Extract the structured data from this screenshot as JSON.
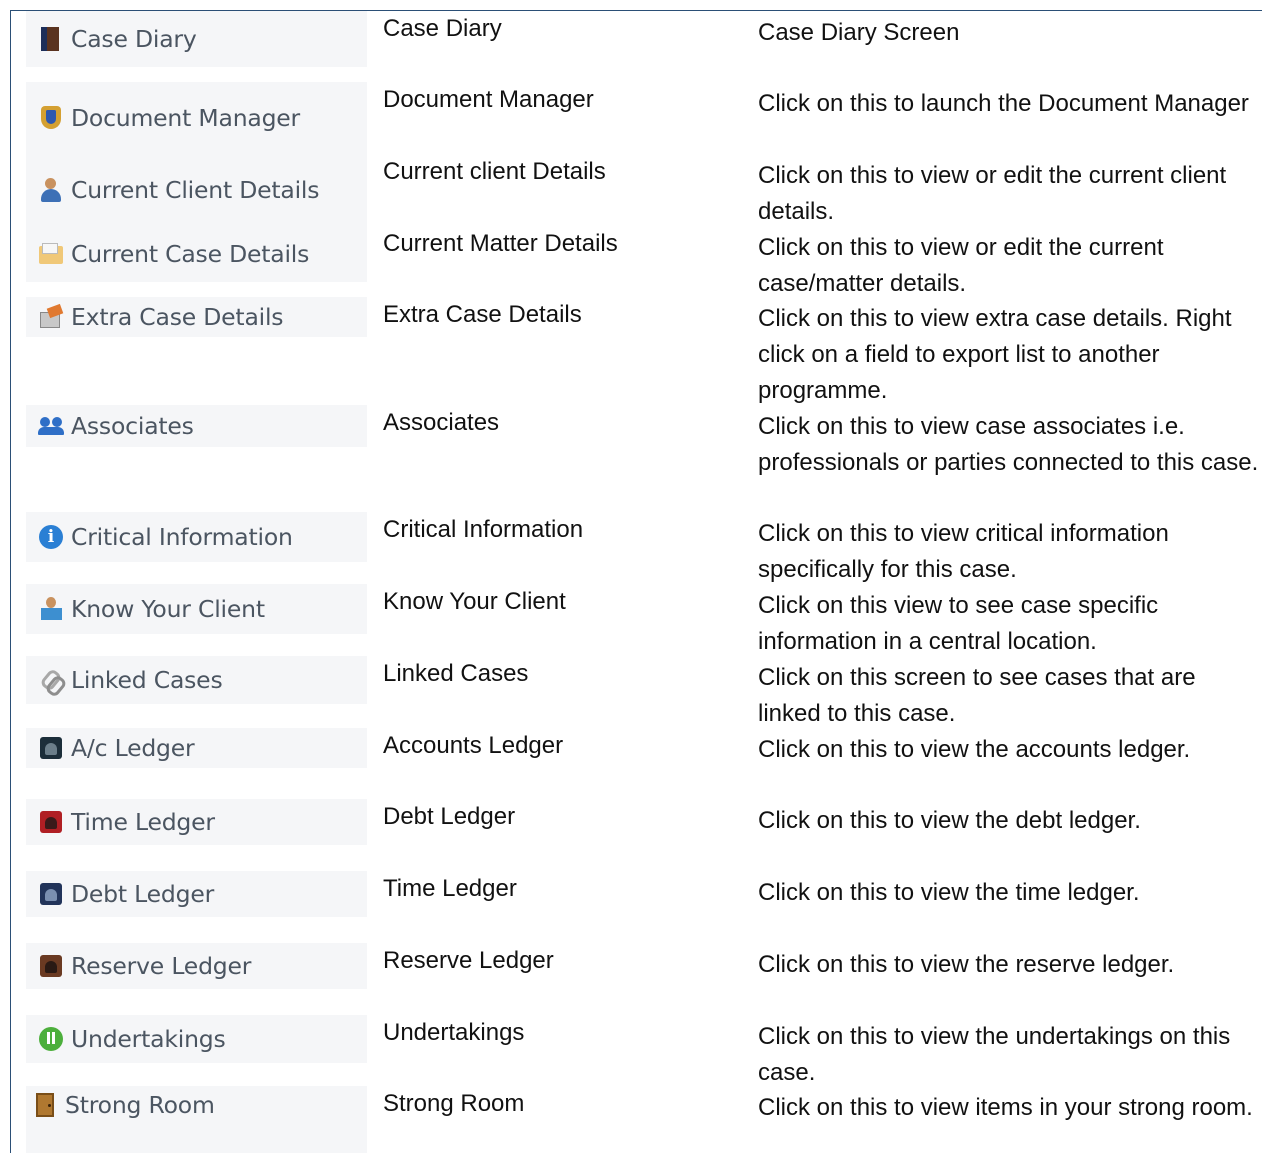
{
  "rows": [
    {
      "button": "Case Diary",
      "icon": "diary-book-icon",
      "name": "Case Diary",
      "description": "Case Diary Screen"
    },
    {
      "button": "Document Manager",
      "icon": "document-shield-icon",
      "name": "Document Manager",
      "description": "Click on this to launch the Document Manager"
    },
    {
      "button": "Current Client Details",
      "icon": "client-person-icon",
      "name": "Current client Details",
      "description": "Click on this to view or edit the current client details."
    },
    {
      "button": "Current Case Details",
      "icon": "case-folder-icon",
      "name": "Current Matter Details",
      "description": "Click on this to view or edit the current case/matter details."
    },
    {
      "button": "Extra Case Details",
      "icon": "extra-box-icon",
      "name": "Extra Case Details",
      "description": "Click on this to view extra case details. Right click on a field to export list to another programme."
    },
    {
      "button": "Associates",
      "icon": "associates-people-icon",
      "name": "Associates",
      "description": "Click on this to view case associates i.e. professionals or parties connected to this case."
    },
    {
      "button": "Critical Information",
      "icon": "info-icon",
      "name": "Critical Information",
      "description": "Click on this to view critical information specifically for this case."
    },
    {
      "button": "Know Your Client",
      "icon": "know-your-client-icon",
      "name": "Know Your Client",
      "description": "Click on this view to see case specific information in a central location."
    },
    {
      "button": "Linked Cases",
      "icon": "chain-link-icon",
      "name": "Linked Cases",
      "description": "Click on this screen to see cases that are linked to this case."
    },
    {
      "button": "A/c Ledger",
      "icon": "ledger-dark-icon",
      "name": "Accounts Ledger",
      "description": "Click on this to view the accounts ledger."
    },
    {
      "button": "Time Ledger",
      "icon": "ledger-red-icon",
      "name": "Debt Ledger",
      "description": "Click on this to view the debt ledger."
    },
    {
      "button": "Debt Ledger",
      "icon": "ledger-blue-icon",
      "name": "Time Ledger",
      "description": "Click on this to view the time ledger."
    },
    {
      "button": "Reserve Ledger",
      "icon": "ledger-brown-icon",
      "name": "Reserve Ledger",
      "description": "Click on this to view the reserve ledger."
    },
    {
      "button": "Undertakings",
      "icon": "undertakings-icon",
      "name": "Undertakings",
      "description": "Click on this to view the undertakings on this case."
    },
    {
      "button": "Strong Room",
      "icon": "strong-room-door-icon",
      "name": "Strong Room",
      "description": "Click on this to view items in your strong room."
    }
  ]
}
